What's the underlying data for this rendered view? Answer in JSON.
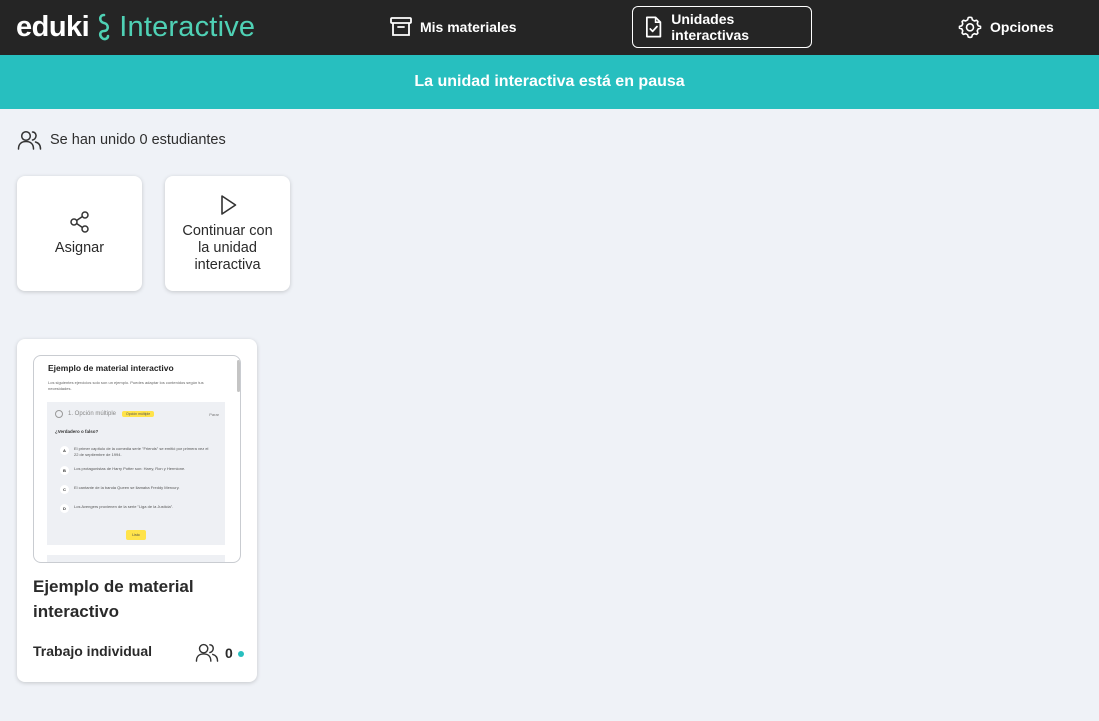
{
  "brand": {
    "name_part1": "eduki",
    "name_part2": "Interactive",
    "accent_color": "#4fd1b5"
  },
  "nav": {
    "materials_label": "Mis materiales",
    "units_label": "Unidades interactivas",
    "options_label": "Opciones"
  },
  "banner": {
    "text": "La unidad interactiva está en pausa",
    "color": "#27bfbf"
  },
  "students": {
    "joined_text": "Se han unido 0 estudiantes"
  },
  "actions": {
    "assign_label": "Asignar",
    "continue_label": "Continuar con la unidad interactiva"
  },
  "material": {
    "title": "Ejemplo de material interactivo",
    "mode": "Trabajo individual",
    "participants": "0",
    "preview": {
      "title": "Ejemplo de material interactivo",
      "subtitle": "Los siguientes ejercicios solo son un ejemplo. Puedes adaptar los contenidos según tus necesidades.",
      "question_header": "1. Opción múltiple",
      "tag": "Opción múltiple",
      "show": "Parar",
      "question": "¿Verdadero o falso?",
      "options": [
        {
          "letter": "A",
          "text": "El primer capítulo de la comedia serie \"Friends\" se emitió por primera vez el 22 de septiembre de 1994."
        },
        {
          "letter": "B",
          "text": "Los protagonistas de Harry Potter son: Harry, Ron y Hermione."
        },
        {
          "letter": "C",
          "text": "El cantante de la banda Queen se llamaba Freddy Mercury."
        },
        {
          "letter": "D",
          "text": "Los Avengers provienen de la serie \"Liga de la Justicia\"."
        }
      ],
      "button": "Listo"
    }
  }
}
